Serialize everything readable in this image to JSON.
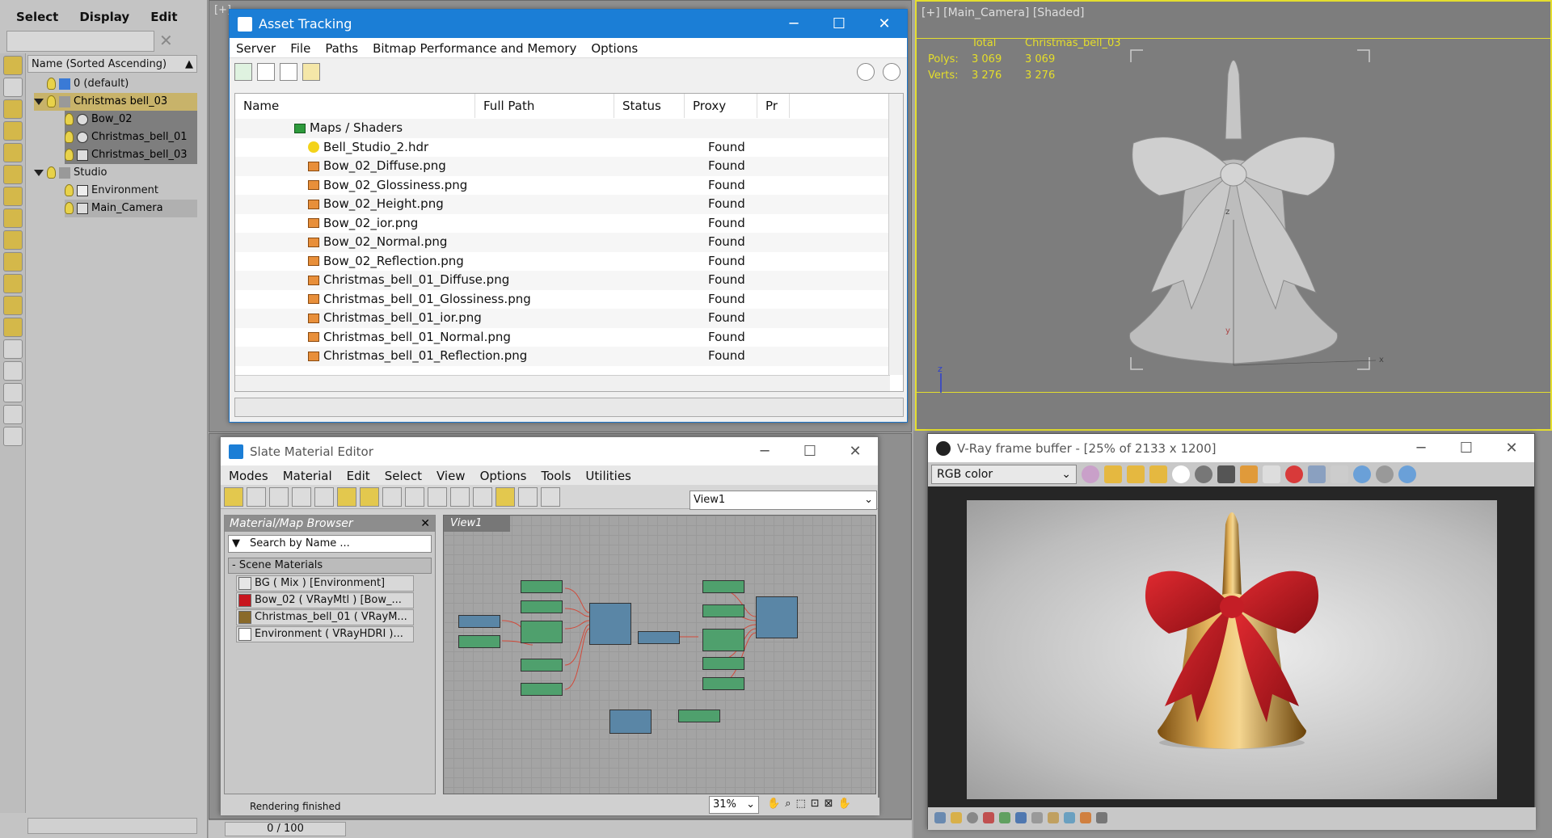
{
  "scene_explorer": {
    "menu": [
      "Select",
      "Display",
      "Edit"
    ],
    "column_header": "Name (Sorted Ascending)",
    "items": [
      {
        "label": "0 (default)"
      },
      {
        "label": "Christmas bell_03"
      },
      {
        "label": "Bow_02"
      },
      {
        "label": "Christmas_bell_01"
      },
      {
        "label": "Christmas_bell_03"
      },
      {
        "label": "Studio"
      },
      {
        "label": "Environment"
      },
      {
        "label": "Main_Camera"
      }
    ]
  },
  "asset_tracking": {
    "title": "Asset Tracking",
    "menu": [
      "Server",
      "File",
      "Paths",
      "Bitmap Performance and Memory",
      "Options"
    ],
    "columns": [
      "Name",
      "Full Path",
      "Status",
      "Proxy Resol...",
      "Pr"
    ],
    "group": "Maps / Shaders",
    "rows": [
      {
        "name": "Bell_Studio_2.hdr",
        "status": "Found"
      },
      {
        "name": "Bow_02_Diffuse.png",
        "status": "Found"
      },
      {
        "name": "Bow_02_Glossiness.png",
        "status": "Found"
      },
      {
        "name": "Bow_02_Height.png",
        "status": "Found"
      },
      {
        "name": "Bow_02_ior.png",
        "status": "Found"
      },
      {
        "name": "Bow_02_Normal.png",
        "status": "Found"
      },
      {
        "name": "Bow_02_Reflection.png",
        "status": "Found"
      },
      {
        "name": "Christmas_bell_01_Diffuse.png",
        "status": "Found"
      },
      {
        "name": "Christmas_bell_01_Glossiness.png",
        "status": "Found"
      },
      {
        "name": "Christmas_bell_01_ior.png",
        "status": "Found"
      },
      {
        "name": "Christmas_bell_01_Normal.png",
        "status": "Found"
      },
      {
        "name": "Christmas_bell_01_Reflection.png",
        "status": "Found"
      }
    ]
  },
  "viewport": {
    "label": "[+] [Main_Camera] [Shaded]",
    "stats_header_total": "Total",
    "stats_header_obj": "Christmas_bell_03",
    "polys_label": "Polys:",
    "polys_total": "3 069",
    "polys_obj": "3 069",
    "verts_label": "Verts:",
    "verts_total": "3 276",
    "verts_obj": "3 276",
    "axis_z": "z",
    "axis_x": "x",
    "grid_axis_y": "y",
    "grid_axis_x": "x",
    "vp_corner_label": "[+]"
  },
  "slate": {
    "title": "Slate Material Editor",
    "menu": [
      "Modes",
      "Material",
      "Edit",
      "Select",
      "View",
      "Options",
      "Tools",
      "Utilities"
    ],
    "view_dropdown": "View1",
    "browser_title": "Material/Map Browser",
    "search_placeholder": "Search by Name ...",
    "section": "- Scene Materials",
    "materials": [
      "BG ( Mix ) [Environment]",
      "Bow_02 ( VRayMtl ) [Bow_...",
      "Christmas_bell_01 ( VRayM...",
      "Environment ( VRayHDRI )..."
    ],
    "view_tab": "View1",
    "status": "Rendering finished",
    "zoom": "31%"
  },
  "timebar": {
    "frame": "0 / 100"
  },
  "vfb": {
    "title": "V-Ray frame buffer - [25% of 2133 x 1200]",
    "channel": "RGB color"
  }
}
